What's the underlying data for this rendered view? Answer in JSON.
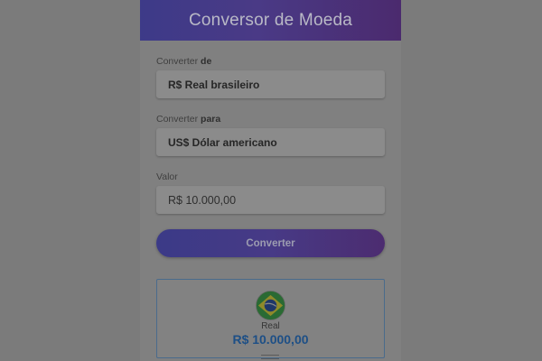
{
  "header": {
    "title": "Conversor de Moeda"
  },
  "form": {
    "from_label_prefix": "Converter ",
    "from_label_emphasis": "de",
    "from_value": "R$ Real brasileiro",
    "to_label_prefix": "Converter ",
    "to_label_emphasis": "para",
    "to_value": "US$ Dólar americano",
    "amount_label": "Valor",
    "amount_value": "R$ 10.000,00",
    "convert_button": "Converter"
  },
  "result": {
    "flag_icon": "brazil-flag-icon",
    "label": "Real",
    "value": "R$ 10.000,00"
  },
  "colors": {
    "accent_start": "#3b3a87",
    "accent_end": "#4c2c70",
    "result_value": "#1d4f86"
  }
}
